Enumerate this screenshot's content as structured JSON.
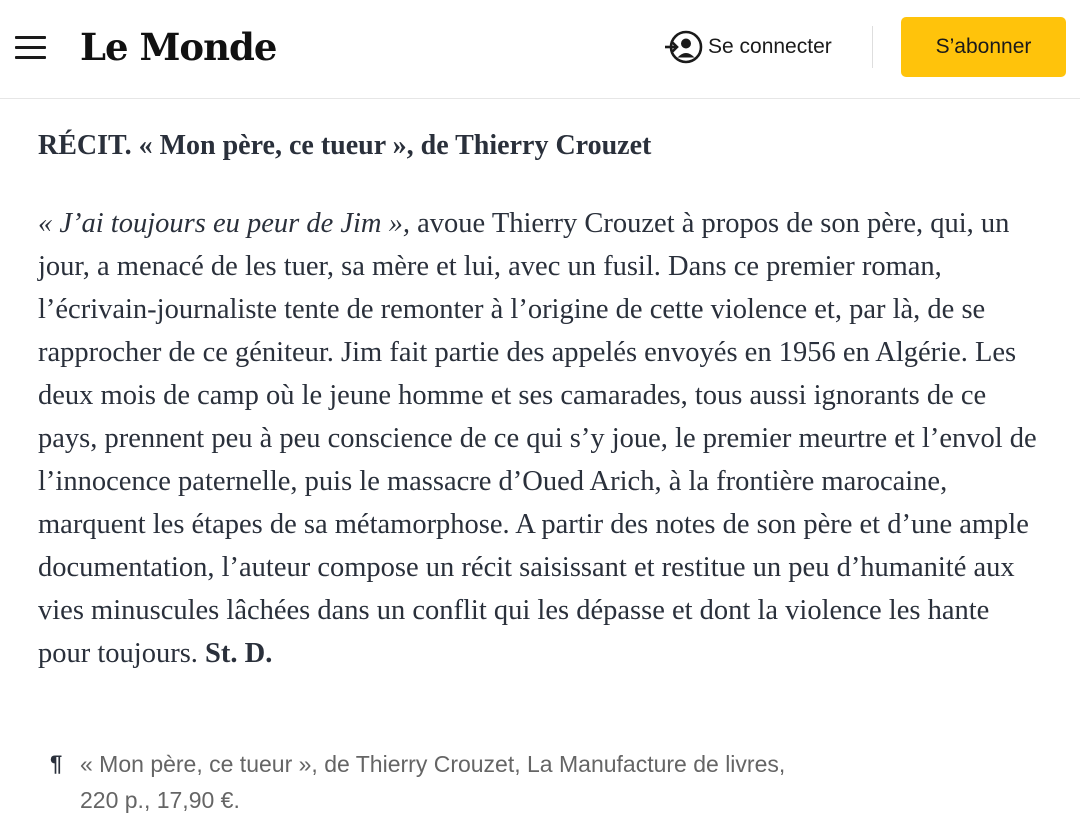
{
  "header": {
    "logo": "Le Monde",
    "login_label": "Se connecter",
    "subscribe_label": "S’abonner",
    "subscribe_color": "#ffc30b",
    "menu_icon": "hamburger-menu-icon",
    "login_icon": "user-login-icon"
  },
  "article": {
    "title": "RÉCIT. « Mon père, ce tueur », de Thierry Crouzet",
    "quote": "« J’ai toujours eu peur de Jim »,",
    "body": " avoue Thierry Crouzet à propos de son père, qui, un jour, a menacé de les tuer, sa mère et lui, avec un fusil. Dans ce premier roman, l’écrivain-journaliste tente de remonter à l’origine de cette violence et, par là, de se rapprocher de ce géniteur. Jim fait partie des appelés envoyés en 1956 en Algérie. Les deux mois de camp où le jeune homme et ses camarades, tous aussi ignorants de ce pays, prennent peu à peu conscience de ce qui s’y joue, le premier meurtre et l’envol de l’innocence paternelle, puis le massacre d’Oued Arich, à la frontière marocaine, marquent les étapes de sa métamorphose. A partir des notes de son père et d’une ample documentation, l’auteur compose un récit saisissant et restitue un peu d’humanité aux vies minuscules lâchées dans un conflit qui les dépasse et dont la violence les hante pour toujours. ",
    "signature": "St. D.",
    "reference_mark": "¶",
    "reference": "« Mon père, ce tueur », de Thierry Crouzet, La Manufacture de livres, 220 p., 17,90 €."
  }
}
